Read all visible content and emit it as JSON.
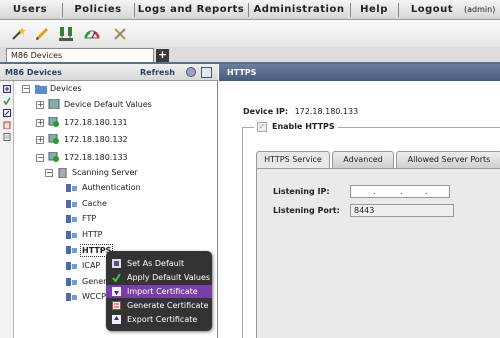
{
  "menu": {
    "items": [
      "Users",
      "Policies",
      "Logs and Reports",
      "Administration",
      "Help",
      "Logout"
    ],
    "user": "(admin)"
  },
  "toolbar": {
    "icons": [
      "wand-icon",
      "pencil-icon",
      "network-icon",
      "gauge-icon",
      "tools-icon"
    ]
  },
  "tabs": {
    "active": "M86 Devices",
    "add": "+"
  },
  "left_panel": {
    "title": "M86 Devices",
    "refresh": "Refresh"
  },
  "tree": {
    "root": "Devices",
    "default_values": "Device Default Values",
    "device1": "172.18.180.131",
    "device2": "172.18.180.132",
    "device3": "172.18.180.133",
    "scanning_server": "Scanning Server",
    "authentication": "Authentication",
    "cache": "Cache",
    "ftp": "FTP",
    "http": "HTTP",
    "https": "HTTPS",
    "icap": "ICAP",
    "general": "Gener",
    "wccp": "WCCP"
  },
  "context_menu": {
    "items": [
      "Set As Default",
      "Apply Default Values",
      "Import Certificate",
      "Generate Certificate",
      "Export Certificate"
    ],
    "selected": "Import Certificate"
  },
  "right_panel": {
    "title": "HTTPS",
    "device_ip_label": "Device IP:",
    "device_ip": "172.18.180.133",
    "enable_https": "Enable HTTPS",
    "tabs": [
      "HTTPS Service",
      "Advanced",
      "Allowed Server Ports"
    ],
    "listening_ip_label": "Listening IP:",
    "listening_port_label": "Listening Port:",
    "listening_port": "8443"
  },
  "colors": {
    "header_blue": "#475a7e",
    "menu_highlight": "#7a3fa6"
  }
}
